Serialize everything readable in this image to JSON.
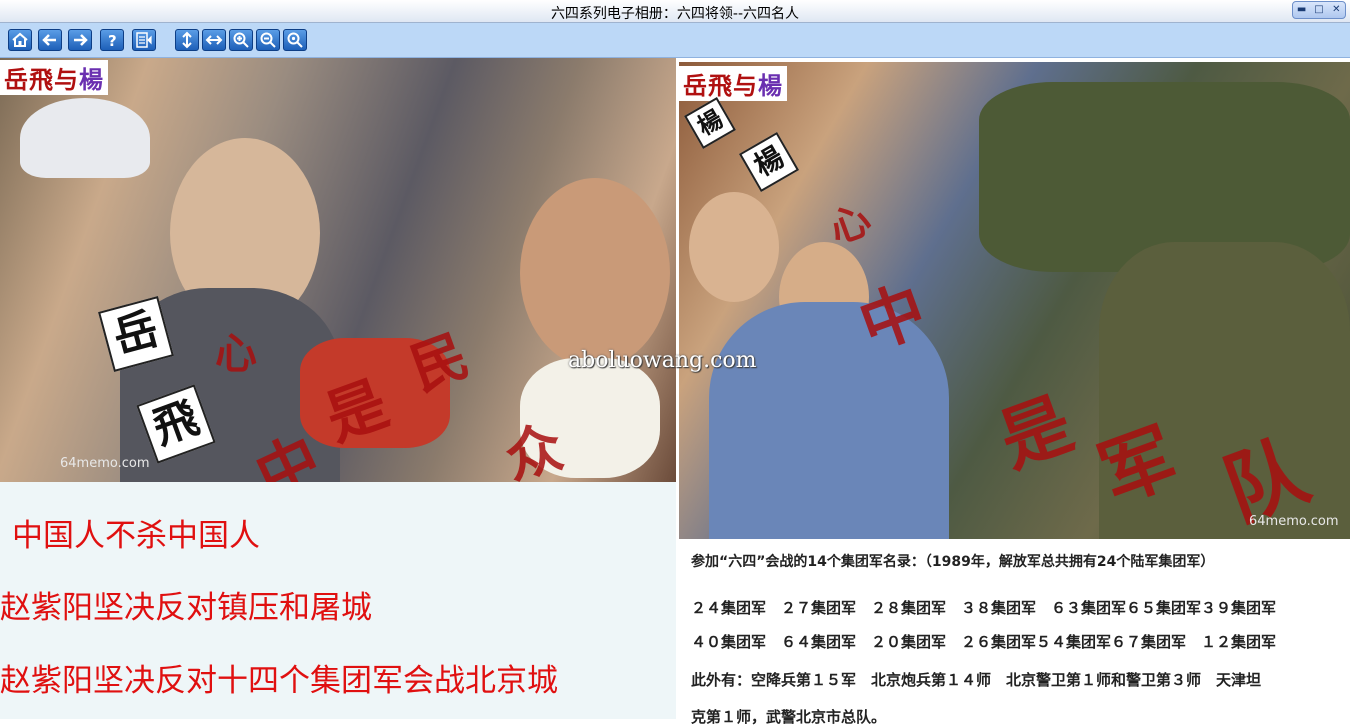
{
  "window": {
    "title": "六四系列电子相册：六四将领--六四名人"
  },
  "toolbar": {
    "buttons": [
      "home-icon",
      "back-arrow-icon",
      "forward-arrow-icon",
      "help-icon",
      "list-icon",
      "fit-height-icon",
      "fit-width-icon",
      "zoom-in-icon",
      "zoom-out-icon",
      "zoom-fit-icon"
    ]
  },
  "photo_left": {
    "logo_a": "岳飛与",
    "logo_b": "楊",
    "stamp_1": "岳",
    "stamp_2": "飛",
    "overlay": [
      "心",
      "中",
      "是",
      "民",
      "众"
    ],
    "credit": "64memo.com"
  },
  "photo_right": {
    "logo_a": "岳飛与",
    "logo_b": "楊",
    "stamp_1": "楊",
    "stamp_2": "楊",
    "overlay": [
      "心",
      "中",
      "是",
      "军",
      "队"
    ],
    "credit": "64memo.com"
  },
  "watermark": "aboluowang.com",
  "slogans": [
    "中国人不杀中国人",
    "赵紫阳坚决反对镇压和屠城",
    "赵紫阳坚决反对十四个集团军会战北京城"
  ],
  "info": {
    "heading": "参加“六四”会战的14个集团军名录：（1989年，解放军总共拥有24个陆军集团军）",
    "line1": "２４集团军　２７集团军　２８集团军　３８集团军　６３集团军６５集团军３９集团军",
    "line2": "４０集团军　６４集团军　２０集团军　２６集团军５４集团军６７集团军　１２集团军",
    "line3": "此外有：空降兵第１５军　北京炮兵第１４师　北京警卫第１师和警卫第３师　天津坦",
    "line4": "克第１师，武警北京市总队。"
  },
  "colors": {
    "slogan": "#e01010",
    "toolbar_bg": "#bcd8f7",
    "button": "#1d5fb8",
    "text_panel_bg": "#eef6f8"
  }
}
